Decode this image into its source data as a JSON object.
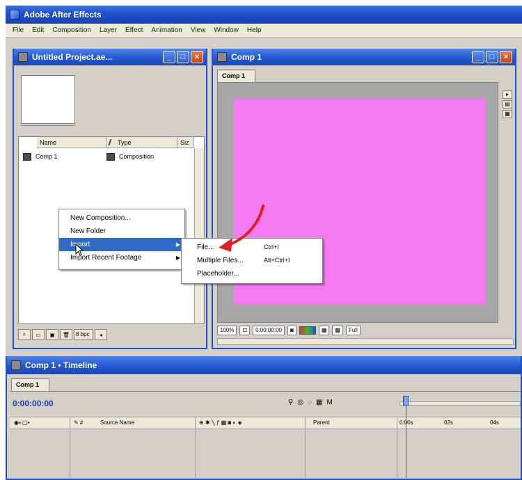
{
  "app": {
    "title": "Adobe After Effects",
    "menu": [
      "File",
      "Edit",
      "Composition",
      "Layer",
      "Effect",
      "Animation",
      "View",
      "Window",
      "Help"
    ]
  },
  "project_panel": {
    "title": "Untitled Project.ae...",
    "columns": [
      "Name",
      "Type",
      "Siz"
    ],
    "items": [
      {
        "name": "Comp 1",
        "type": "Composition"
      }
    ],
    "bottom_bpc": "8 bpc"
  },
  "comp_panel": {
    "title": "Comp 1",
    "tab": "Comp 1",
    "zoom": "100%",
    "timecode": "0:00:00:00",
    "resolution": "Full",
    "canvas_color": "#f47af2"
  },
  "context_menu": {
    "items": [
      {
        "label": "New Composition...",
        "has_submenu": false,
        "selected": false
      },
      {
        "label": "New Folder",
        "has_submenu": false,
        "selected": false
      },
      {
        "label": "Import",
        "has_submenu": true,
        "selected": true
      },
      {
        "label": "Import Recent Footage",
        "has_submenu": true,
        "selected": false
      }
    ]
  },
  "submenu": {
    "items": [
      {
        "label": "File...",
        "shortcut": "Ctrl+I"
      },
      {
        "label": "Multiple Files...",
        "shortcut": "Alt+Ctrl+I"
      },
      {
        "label": "Placeholder...",
        "shortcut": ""
      }
    ]
  },
  "timeline_panel": {
    "title": "Comp 1 • Timeline",
    "tab": "Comp 1",
    "timecode": "0:00:00:00",
    "columns": [
      "Source Name",
      "Parent"
    ],
    "ruler_labels": [
      "0:00s",
      "02s",
      "04s"
    ]
  },
  "colors": {
    "titlebar": "#2659d2",
    "selection": "#316ac5",
    "annotation": "#e02020"
  }
}
